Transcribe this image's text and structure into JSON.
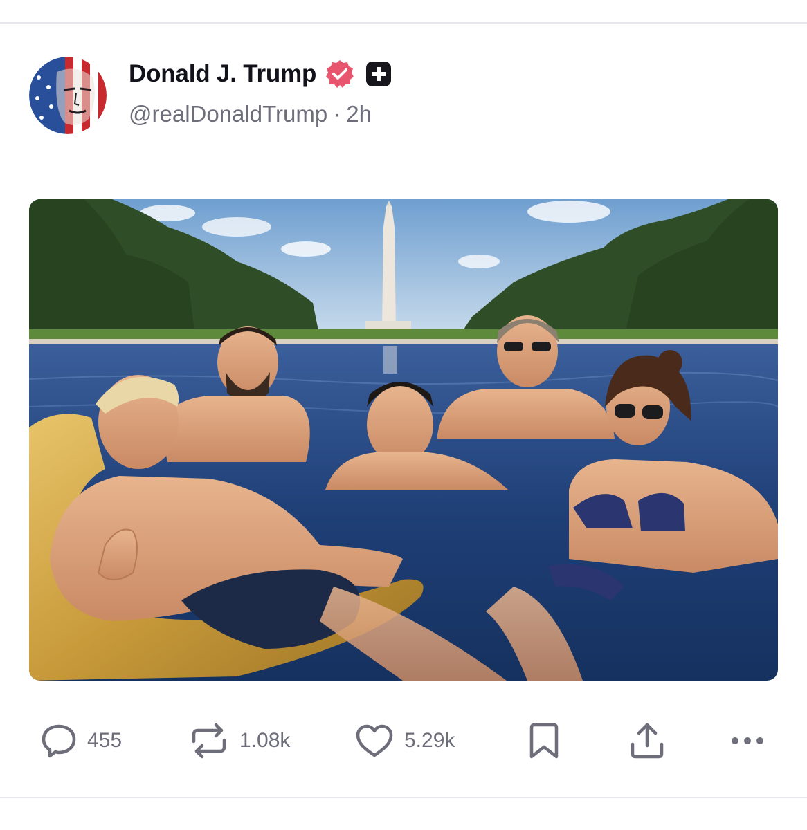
{
  "post": {
    "author": {
      "display_name": "Donald J. Trump",
      "handle": "@realDonaldTrump",
      "separator": "·",
      "time_ago": "2h",
      "verified_icon": "verified-badge-icon",
      "verified_color": "#e8556e",
      "subscriber_icon": "plus-badge-icon"
    },
    "media": {
      "image_alt": ""
    },
    "actions": {
      "reply_count": "455",
      "repost_count": "1.08k",
      "like_count": "5.29k",
      "bookmark_icon": "bookmark-icon",
      "share_icon": "share-icon",
      "more_icon": "more-icon"
    }
  },
  "colors": {
    "text_primary": "#12121a",
    "text_secondary": "#6e6e7a",
    "divider": "#e6e6ec"
  }
}
